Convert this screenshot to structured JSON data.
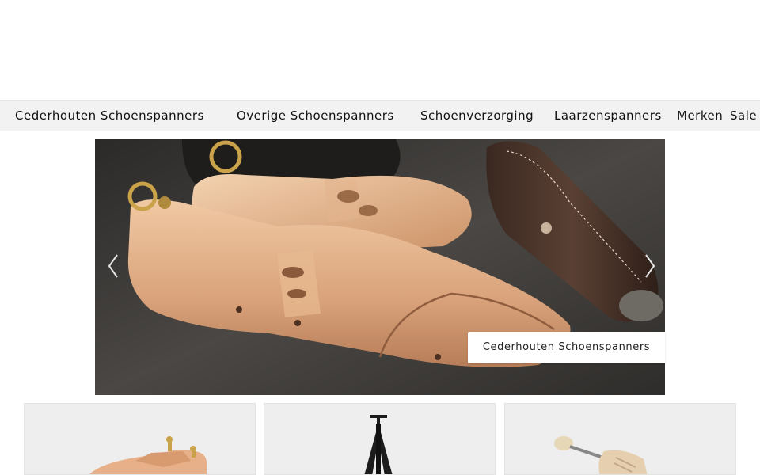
{
  "nav": {
    "items": [
      {
        "label": "Cederhouten Schoenspanners"
      },
      {
        "label": "Overige Schoenspanners"
      },
      {
        "label": "Schoenverzorging"
      },
      {
        "label": "Laarzenspanners"
      },
      {
        "label": "Merken"
      },
      {
        "label": "Sale"
      }
    ]
  },
  "hero": {
    "caption": "Cederhouten Schoenspanners",
    "prev_icon": "chevron-left-icon",
    "next_icon": "chevron-right-icon"
  },
  "tiles": [
    {
      "image": "wooden-shoe-trees"
    },
    {
      "image": "black-boot-shaper"
    },
    {
      "image": "spring-shoe-tree"
    }
  ]
}
